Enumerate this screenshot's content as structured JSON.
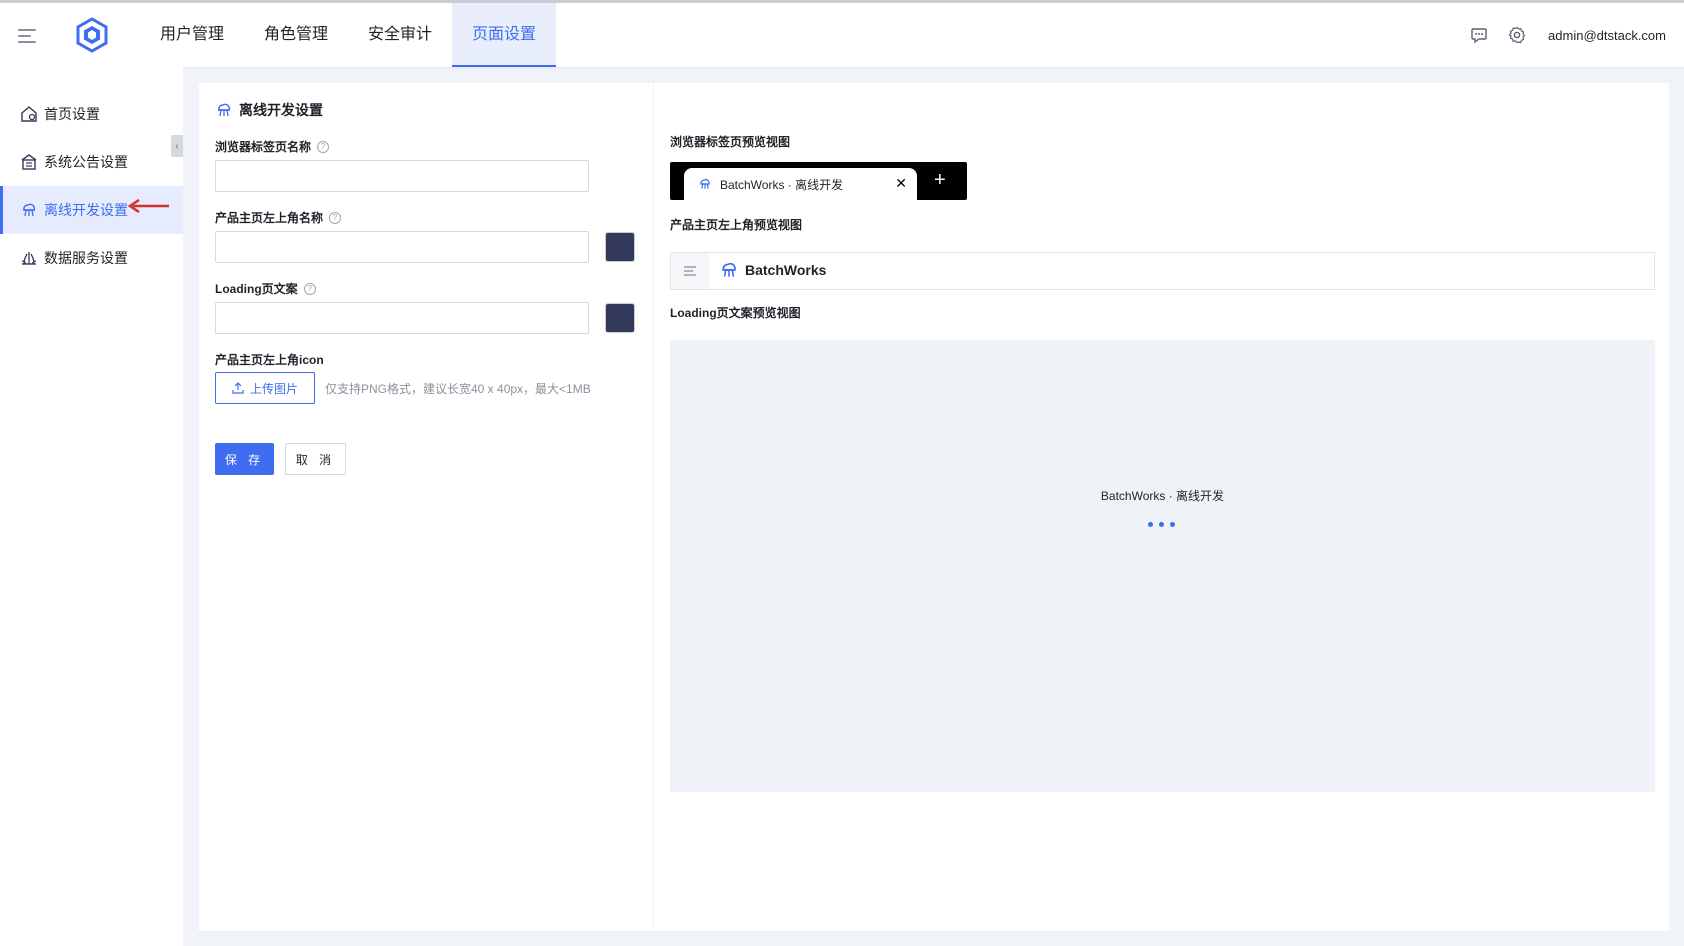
{
  "topbar": {
    "nav": [
      {
        "label": "用户管理"
      },
      {
        "label": "角色管理"
      },
      {
        "label": "安全审计"
      },
      {
        "label": "页面设置",
        "active": true
      }
    ],
    "user_email": "admin@dtstack.com"
  },
  "sidebar": {
    "items": [
      {
        "label": "首页设置",
        "icon": "home-settings-icon"
      },
      {
        "label": "系统公告设置",
        "icon": "announcement-icon"
      },
      {
        "label": "离线开发设置",
        "icon": "batch-cloud-icon",
        "active": true
      },
      {
        "label": "数据服务设置",
        "icon": "data-service-icon"
      }
    ]
  },
  "form": {
    "title": "离线开发设置",
    "browser_tab_name_label": "浏览器标签页名称",
    "browser_tab_name_value": "",
    "header_name_label": "产品主页左上角名称",
    "header_name_value": "",
    "header_name_color": "#333a5c",
    "loading_text_label": "Loading页文案",
    "loading_text_value": "",
    "loading_text_color": "#333a5c",
    "icon_label": "产品主页左上角icon",
    "upload_label": "上传图片",
    "upload_hint": "仅支持PNG格式，建议长宽40 x 40px，最大<1MB",
    "save_label": "保 存",
    "cancel_label": "取 消"
  },
  "preview": {
    "tab_preview_label": "浏览器标签页预览视图",
    "tab_title": "BatchWorks · 离线开发",
    "tab_close": "✕",
    "tab_add": "+",
    "header_preview_label": "产品主页左上角预览视图",
    "header_brand": "BatchWorks",
    "loading_preview_label": "Loading页文案预览视图",
    "loading_text": "BatchWorks · 离线开发"
  },
  "colors": {
    "accent": "#3f6cf0",
    "swatch": "#333a5c"
  }
}
